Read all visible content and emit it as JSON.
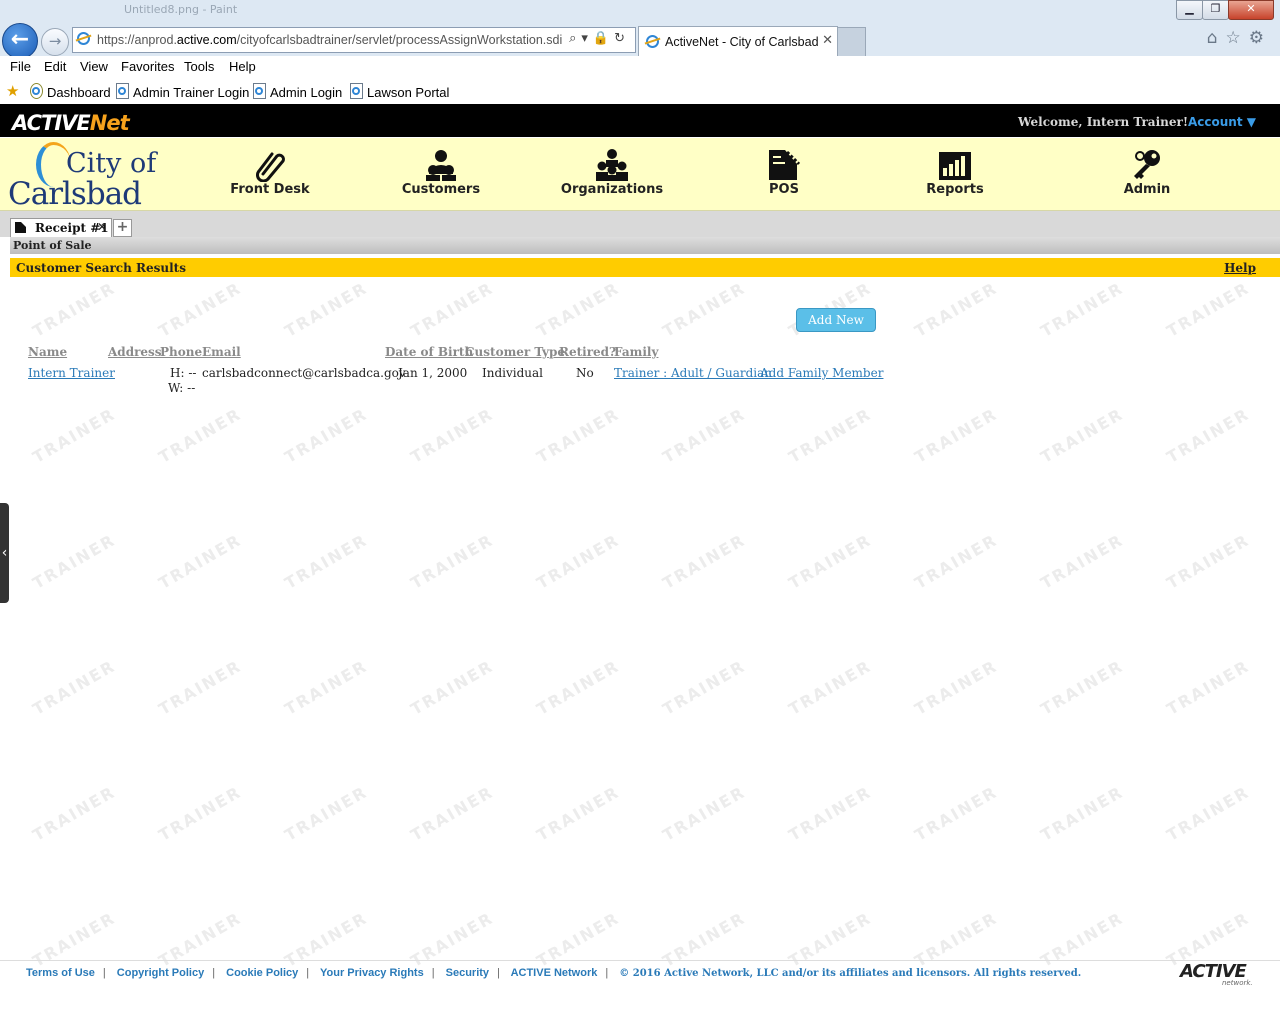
{
  "browser": {
    "window_title": "Untitled8.png - Paint",
    "url_prefix": "https://anprod.",
    "url_domain": "active.com",
    "url_path": "/cityofcarlsbadtrainer/servlet/processAssignWorkstation.sdi",
    "tab_title": "ActiveNet - City of Carlsbad",
    "menu": [
      "File",
      "Edit",
      "View",
      "Favorites",
      "Tools",
      "Help"
    ],
    "favorites": [
      "Dashboard",
      "Admin Trainer Login",
      "Admin Login",
      "Lawson Portal"
    ]
  },
  "app": {
    "logo_main": "ACTIVE",
    "logo_net": "Net",
    "welcome": "Welcome, Intern Trainer!",
    "account": "Account ▼",
    "city_line1": "City of",
    "city_line2": "Carlsbad",
    "nav": [
      "Front Desk",
      "Customers",
      "Organizations",
      "POS",
      "Reports",
      "Admin"
    ]
  },
  "page": {
    "receipt_tab": "Receipt #1",
    "section": "Point of Sale",
    "title": "Customer Search Results",
    "help": "Help",
    "add_new": "Add New",
    "watermark": "TRAINER",
    "columns": [
      "Name",
      "Address",
      "Phone",
      "Email",
      "Date of Birth",
      "Customer Type",
      "Retired?",
      "Family"
    ],
    "row": {
      "name": "Intern Trainer",
      "address": "",
      "phone_h": "H: --",
      "phone_w": "W: --",
      "email": "carlsbadconnect@carlsbadca.gov",
      "dob": "Jan 1, 2000",
      "type": "Individual",
      "retired": "No",
      "family": "Trainer : Adult / Guardian",
      "add_family": "Add Family Member"
    }
  },
  "footer": {
    "links": [
      "Terms of Use",
      "Copyright Policy",
      "Cookie Policy",
      "Your Privacy Rights",
      "Security",
      "ACTIVE Network"
    ],
    "copyright": "© 2016 Active Network, LLC and/or its affiliates and licensors. All rights reserved.",
    "logo": "ACTIVE",
    "logo_sub": "network."
  }
}
